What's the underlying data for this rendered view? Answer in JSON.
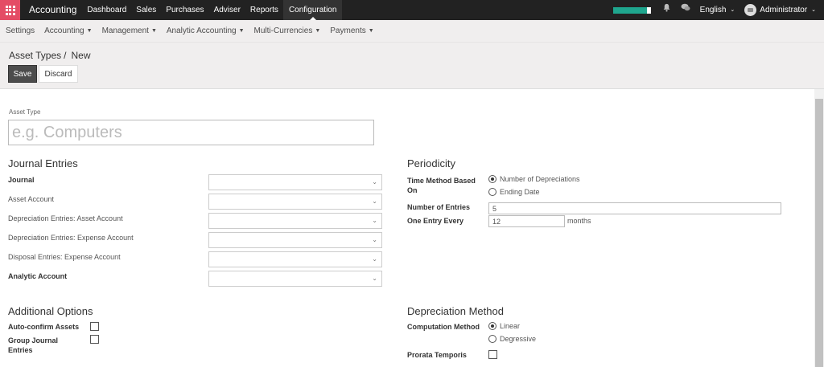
{
  "app": {
    "brand": "Accounting"
  },
  "topnav": [
    "Dashboard",
    "Sales",
    "Purchases",
    "Adviser",
    "Reports",
    "Configuration"
  ],
  "topnav_active": "Configuration",
  "systray": {
    "progress_percent": 90,
    "progress_color": "#1fa68e",
    "language": "English",
    "user": "Administrator"
  },
  "submenu": [
    {
      "label": "Settings",
      "dropdown": false
    },
    {
      "label": "Accounting",
      "dropdown": true
    },
    {
      "label": "Management",
      "dropdown": true
    },
    {
      "label": "Analytic Accounting",
      "dropdown": true
    },
    {
      "label": "Multi-Currencies",
      "dropdown": true
    },
    {
      "label": "Payments",
      "dropdown": true
    }
  ],
  "breadcrumb": {
    "parent": "Asset Types",
    "separator": "/",
    "current": "New"
  },
  "buttons": {
    "save": "Save",
    "discard": "Discard"
  },
  "form": {
    "asset_type_label": "Asset Type",
    "asset_type_placeholder": "e.g. Computers",
    "journal_entries": {
      "title": "Journal Entries",
      "fields": [
        {
          "label": "Journal",
          "bold": true
        },
        {
          "label": "Asset Account",
          "bold": false
        },
        {
          "label": "Depreciation Entries: Asset Account",
          "bold": false
        },
        {
          "label": "Depreciation Entries: Expense Account",
          "bold": false
        },
        {
          "label": "Disposal Entries: Expense Account",
          "bold": false
        },
        {
          "label": "Analytic Account",
          "bold": true
        }
      ]
    },
    "periodicity": {
      "title": "Periodicity",
      "time_method_label": "Time Method Based On",
      "time_method_options": [
        {
          "label": "Number of Depreciations",
          "selected": true
        },
        {
          "label": "Ending Date",
          "selected": false
        }
      ],
      "number_of_entries_label": "Number of Entries",
      "number_of_entries": "5",
      "one_entry_every_label": "One Entry Every",
      "one_entry_every": "12",
      "one_entry_every_unit": "months"
    },
    "additional_options": {
      "title": "Additional Options",
      "auto_confirm_label": "Auto-confirm Assets",
      "auto_confirm": false,
      "group_entries_label": "Group Journal Entries",
      "group_entries": false
    },
    "depreciation_method": {
      "title": "Depreciation Method",
      "computation_label": "Computation Method",
      "computation_options": [
        {
          "label": "Linear",
          "selected": true
        },
        {
          "label": "Degressive",
          "selected": false
        }
      ],
      "prorata_label": "Prorata Temporis",
      "prorata": false
    }
  }
}
